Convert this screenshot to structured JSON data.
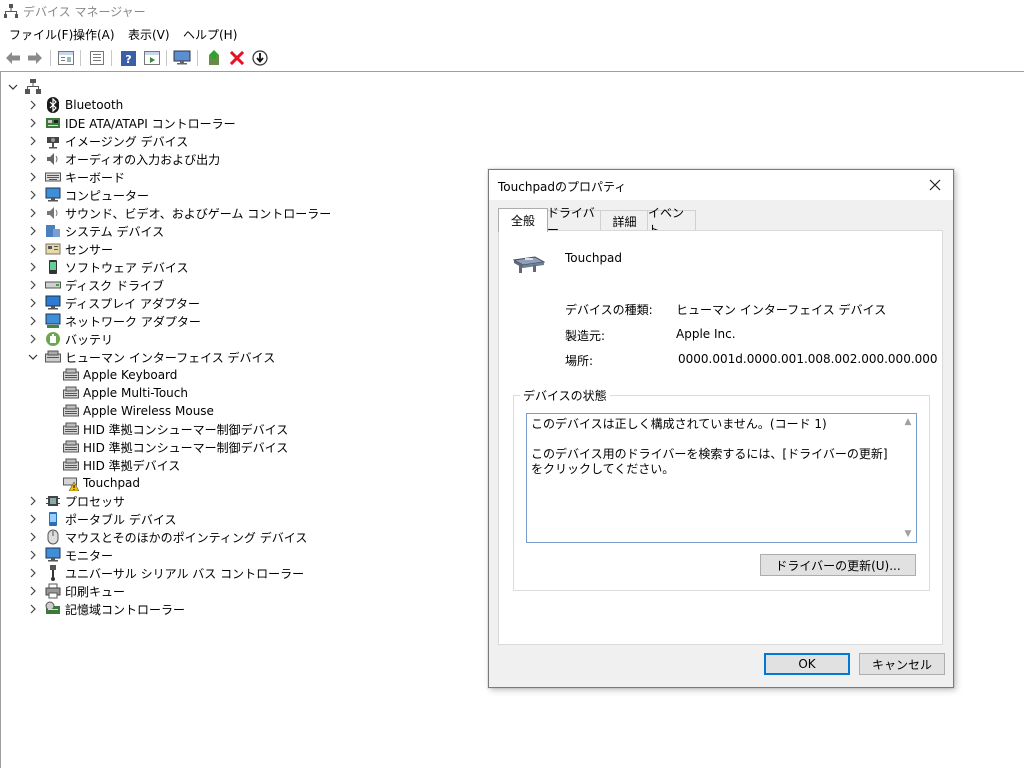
{
  "window": {
    "title": "デバイス マネージャー",
    "menu": [
      "ファイル(F)",
      "操作(A)",
      "表示(V)",
      "ヘルプ(H)"
    ]
  },
  "toolbar": {
    "buttons": [
      "back-icon",
      "forward-icon",
      "properties-icon",
      "show-hide-icon",
      "help-icon",
      "action-pane-icon",
      "monitor-icon",
      "update-driver-icon",
      "uninstall-icon",
      "disable-icon"
    ]
  },
  "tree": {
    "categories": [
      {
        "label": "Bluetooth",
        "icon": "bluetooth-icon"
      },
      {
        "label": "IDE ATA/ATAPI コントローラー",
        "icon": "ide-controller-icon"
      },
      {
        "label": "イメージング デバイス",
        "icon": "camera-icon"
      },
      {
        "label": "オーディオの入力および出力",
        "icon": "speaker-icon"
      },
      {
        "label": "キーボード",
        "icon": "keyboard-icon"
      },
      {
        "label": "コンピューター",
        "icon": "computer-icon"
      },
      {
        "label": "サウンド、ビデオ、およびゲーム コントローラー",
        "icon": "sound-icon"
      },
      {
        "label": "システム デバイス",
        "icon": "system-device-icon"
      },
      {
        "label": "センサー",
        "icon": "sensor-icon"
      },
      {
        "label": "ソフトウェア デバイス",
        "icon": "software-device-icon"
      },
      {
        "label": "ディスク ドライブ",
        "icon": "disk-drive-icon"
      },
      {
        "label": "ディスプレイ アダプター",
        "icon": "display-adapter-icon"
      },
      {
        "label": "ネットワーク アダプター",
        "icon": "network-adapter-icon"
      },
      {
        "label": "バッテリ",
        "icon": "battery-icon"
      },
      {
        "label": "ヒューマン インターフェイス デバイス",
        "icon": "hid-icon",
        "expanded": true,
        "children": [
          {
            "label": "Apple Keyboard",
            "icon": "hid-device-icon"
          },
          {
            "label": "Apple Multi-Touch",
            "icon": "hid-device-icon"
          },
          {
            "label": "Apple Wireless Mouse",
            "icon": "hid-device-icon"
          },
          {
            "label": "HID 準拠コンシューマー制御デバイス",
            "icon": "hid-device-icon"
          },
          {
            "label": "HID 準拠コンシューマー制御デバイス",
            "icon": "hid-device-icon"
          },
          {
            "label": "HID 準拠デバイス",
            "icon": "hid-device-icon"
          },
          {
            "label": "Touchpad",
            "icon": "warning-device-icon"
          }
        ]
      },
      {
        "label": "プロセッサ",
        "icon": "processor-icon"
      },
      {
        "label": "ポータブル デバイス",
        "icon": "portable-device-icon"
      },
      {
        "label": "マウスとそのほかのポインティング デバイス",
        "icon": "mouse-icon"
      },
      {
        "label": "モニター",
        "icon": "monitor-icon"
      },
      {
        "label": "ユニバーサル シリアル バス コントローラー",
        "icon": "usb-icon"
      },
      {
        "label": "印刷キュー",
        "icon": "printer-icon"
      },
      {
        "label": "記憶域コントローラー",
        "icon": "storage-controller-icon"
      }
    ]
  },
  "dialog": {
    "title": "Touchpadのプロパティ",
    "tabs": [
      "全般",
      "ドライバー",
      "詳細",
      "イベント"
    ],
    "device_name": "Touchpad",
    "fields": [
      {
        "label": "デバイスの種類:",
        "value": "ヒューマン インターフェイス デバイス"
      },
      {
        "label": "製造元:",
        "value": "Apple Inc."
      },
      {
        "label": "場所:",
        "value": "0000.001d.0000.001.008.002.000.000.000"
      }
    ],
    "status_caption": "デバイスの状態",
    "status_text": "このデバイスは正しく構成されていません。(コード 1)\n\nこのデバイス用のドライバーを検索するには、[ドライバーの更新] をクリックしてください。",
    "update_button": "ドライバーの更新(U)...",
    "ok_button": "OK",
    "cancel_button": "キャンセル"
  },
  "colors": {
    "accent": "#0078d7",
    "warning": "#f2c200",
    "error": "#e81123"
  }
}
